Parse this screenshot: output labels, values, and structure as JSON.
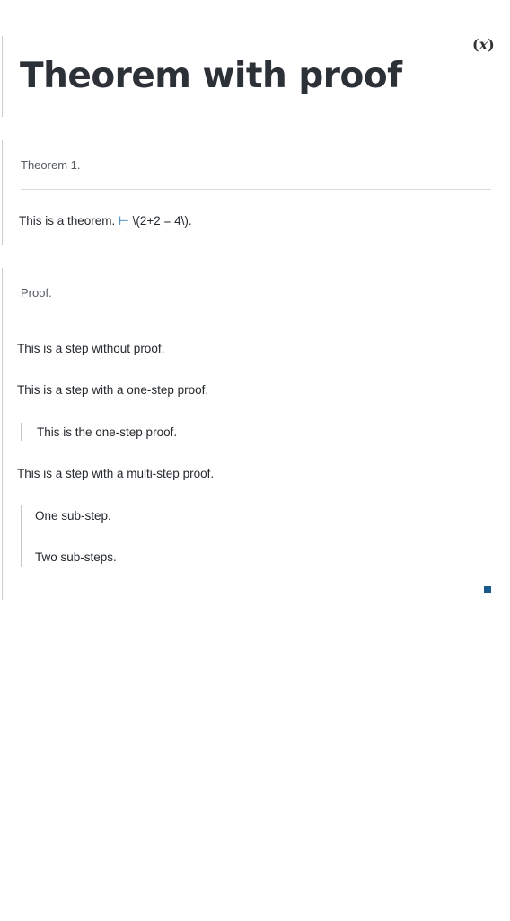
{
  "toggle": {
    "label": "x"
  },
  "page": {
    "title": "Theorem with proof"
  },
  "theorem": {
    "heading": "Theorem 1.",
    "statement_text": "This is a theorem.",
    "turnstile": "⊢",
    "formula": "\\(2+2 = 4\\)."
  },
  "proof": {
    "heading": "Proof.",
    "steps": [
      "This is a step without proof.",
      "This is a step with a one-step proof.",
      "This is the one-step proof.",
      "This is a step with a multi-step proof.",
      "One sub-step.",
      "Two sub-steps."
    ],
    "qed_symbol": "■"
  }
}
